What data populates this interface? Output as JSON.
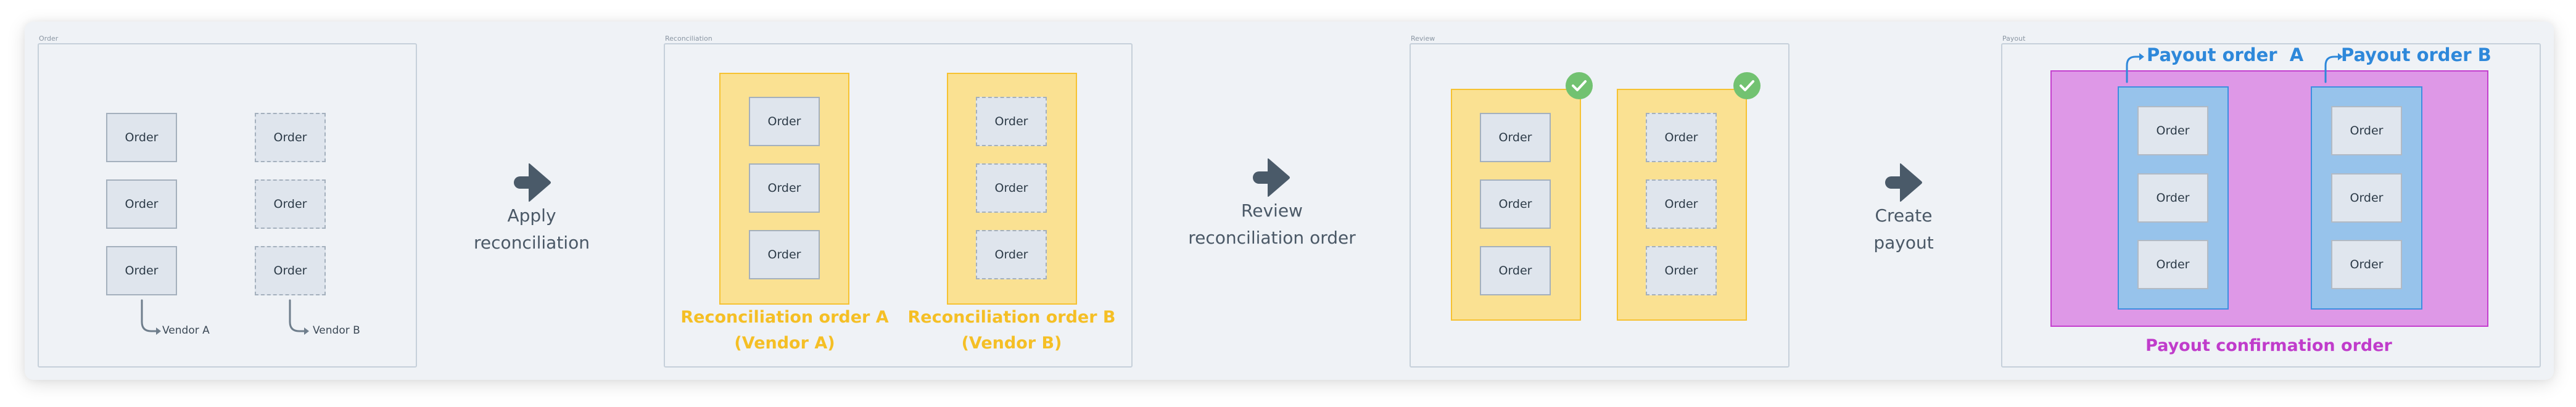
{
  "panels": {
    "order": {
      "label": "Order",
      "column_a": [
        "Order",
        "Order",
        "Order"
      ],
      "column_b": [
        "Order",
        "Order",
        "Order"
      ],
      "vendor_a": "Vendor A",
      "vendor_b": "Vendor B"
    },
    "reconciliation": {
      "label": "Reconciliation",
      "group_a": {
        "orders": [
          "Order",
          "Order",
          "Order"
        ],
        "title": "Reconciliation order A",
        "subtitle": "(Vendor A)"
      },
      "group_b": {
        "orders": [
          "Order",
          "Order",
          "Order"
        ],
        "title": "Reconciliation order B",
        "subtitle": "(Vendor B)"
      }
    },
    "review": {
      "label": "Review",
      "group_a": {
        "orders": [
          "Order",
          "Order",
          "Order"
        ],
        "status": "approved"
      },
      "group_b": {
        "orders": [
          "Order",
          "Order",
          "Order"
        ],
        "status": "approved"
      }
    },
    "payout": {
      "label": "Payout",
      "payout_a": {
        "title": "Payout order  A",
        "orders": [
          "Order",
          "Order",
          "Order"
        ]
      },
      "payout_b": {
        "title": "Payout order B",
        "orders": [
          "Order",
          "Order",
          "Order"
        ]
      },
      "confirmation": "Payout confirmation order"
    }
  },
  "steps": [
    {
      "icon": "arrow-right-icon",
      "line1": "Apply",
      "line2": "reconciliation"
    },
    {
      "icon": "arrow-right-icon",
      "line1": "Review",
      "line2": "reconciliation order"
    },
    {
      "icon": "arrow-right-icon",
      "line1": "Create",
      "line2": "payout"
    }
  ],
  "colors": {
    "reconciliation_fill": "#fae192",
    "reconciliation_border": "#f6c232",
    "reconciliation_text": "#f5bf25",
    "payout_fill": "#97c3eb",
    "payout_text": "#2e88da",
    "confirmation_fill": "#de98e7",
    "confirmation_text": "#c03ccb",
    "approved": "#72c271",
    "step_arrow": "#4a5a69"
  }
}
